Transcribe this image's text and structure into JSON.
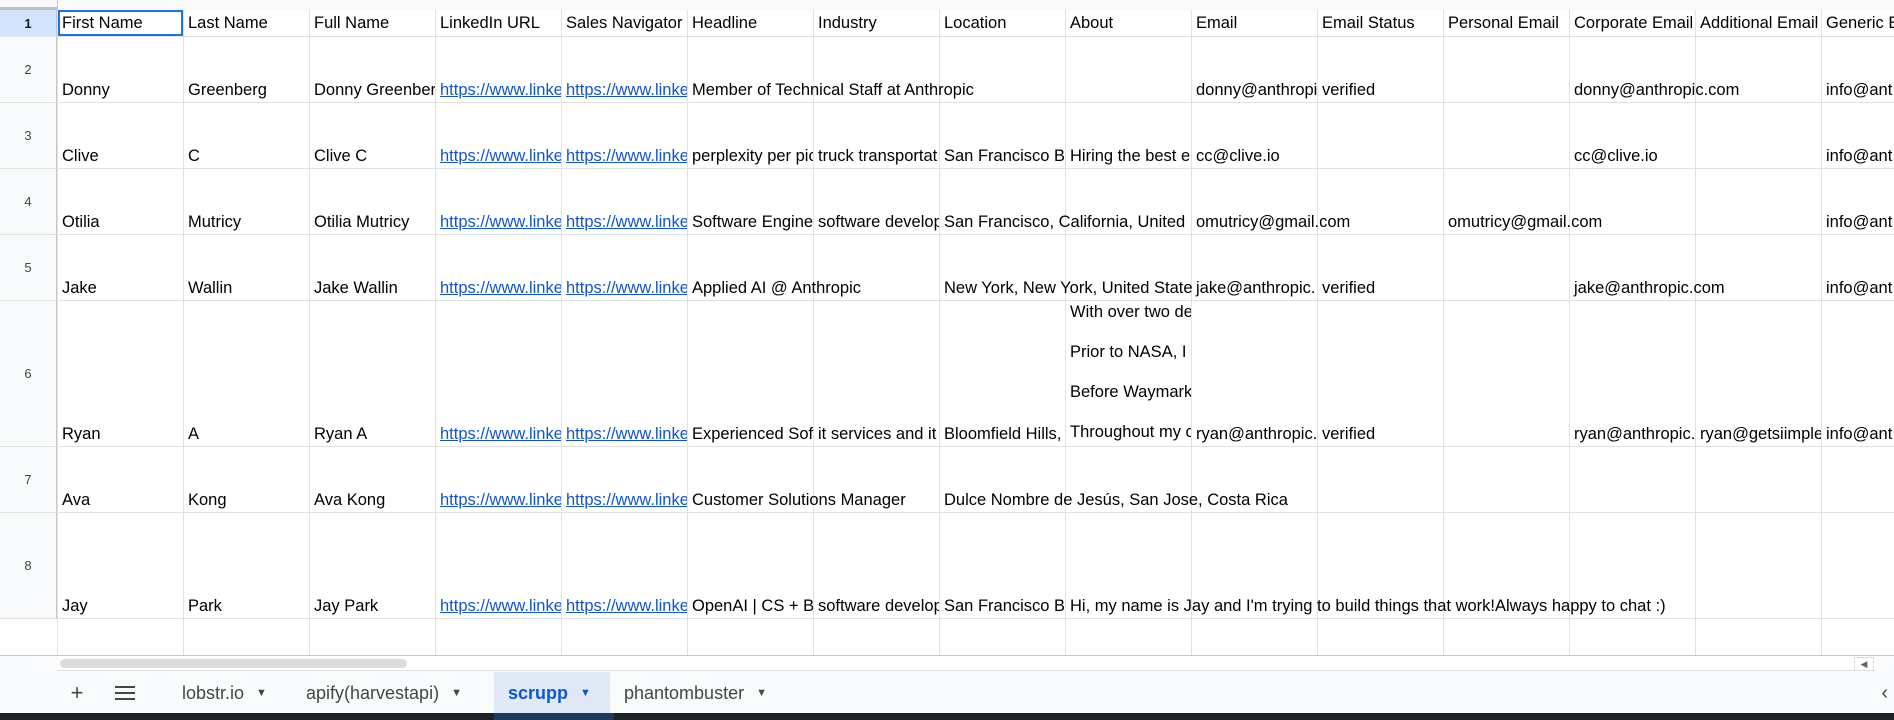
{
  "sheet": {
    "columns": [
      "First Name",
      "Last Name",
      "Full Name",
      "LinkedIn URL",
      "Sales Navigator",
      "Headline",
      "Industry",
      "Location",
      "About",
      "Email",
      "Email Status",
      "Personal Email",
      "Corporate Email",
      "Additional Email",
      "Generic E"
    ],
    "row_numbers": [
      "1",
      "2",
      "3",
      "4",
      "5",
      "6",
      "7",
      "8"
    ],
    "rows": [
      {
        "first": "Donny",
        "last": "Greenberg",
        "full": "Donny Greenber",
        "linkedin": "https://www.linke",
        "salesnav": "https://www.linke",
        "headline": "Member of Technical Staff at Anthropic",
        "industry": "",
        "location": "",
        "about": "",
        "email": "donny@anthropi",
        "email_status": "verified",
        "personal_email": "",
        "corporate_email": "donny@anthropic.com",
        "additional_email": "",
        "generic": "info@ant"
      },
      {
        "first": "Clive",
        "last": "C",
        "full": "Clive C",
        "linkedin": "https://www.linke",
        "salesnav": "https://www.linke",
        "headline": "perplexity per pic",
        "industry": "truck transportat",
        "location": "San Francisco B",
        "about": "Hiring the best e",
        "email": "cc@clive.io",
        "email_status": "",
        "personal_email": "",
        "corporate_email": "cc@clive.io",
        "additional_email": "",
        "generic": "info@ant"
      },
      {
        "first": "Otilia",
        "last": "Mutricy",
        "full": "Otilia Mutricy",
        "linkedin": "https://www.linke",
        "salesnav": "https://www.linke",
        "headline": "Software Engine",
        "industry": "software develop",
        "location": "San Francisco, California, United",
        "about": "",
        "email": "omutricy@gmail.com",
        "email_status": "",
        "personal_email": "omutricy@gmail.com",
        "corporate_email": "",
        "additional_email": "",
        "generic": "info@ant"
      },
      {
        "first": "Jake",
        "last": "Wallin",
        "full": "Jake Wallin",
        "linkedin": "https://www.linke",
        "salesnav": "https://www.linke",
        "headline": "Applied AI @ Anthropic",
        "industry": "",
        "location": "New York, New York, United State",
        "about": "",
        "email": "jake@anthropic.",
        "email_status": "verified",
        "personal_email": "",
        "corporate_email": "jake@anthropic.com",
        "additional_email": "",
        "generic": "info@ant"
      },
      {
        "first": "Ryan",
        "last": "A",
        "full": "Ryan A",
        "linkedin": "https://www.linke",
        "salesnav": "https://www.linke",
        "headline": "Experienced Sof",
        "industry": "it services and it",
        "location": "Bloomfield Hills,",
        "about_lines": [
          "With over two de",
          "Prior to NASA, I",
          "Before Waymark",
          "Throughout my c"
        ],
        "email": "ryan@anthropic.",
        "email_status": "verified",
        "personal_email": "",
        "corporate_email": "ryan@anthropic.",
        "additional_email": "ryan@getsiimple",
        "generic": "info@ant"
      },
      {
        "first": "Ava",
        "last": "Kong",
        "full": "Ava Kong",
        "linkedin": "https://www.linke",
        "salesnav": "https://www.linke",
        "headline": "Customer Solutions Manager",
        "industry": "",
        "location": "Dulce Nombre de Jesús, San Jose, Costa Rica",
        "about": "",
        "email": "",
        "email_status": "",
        "personal_email": "",
        "corporate_email": "",
        "additional_email": "",
        "generic": ""
      },
      {
        "first": "Jay",
        "last": "Park",
        "full": "Jay Park",
        "linkedin": "https://www.linke",
        "salesnav": "https://www.linke",
        "headline": "OpenAI | CS + B",
        "industry": "software develop",
        "location": "San Francisco B",
        "about": "Hi, my name is Jay and I'm trying to build things that work!Always happy to chat :)",
        "email": "",
        "email_status": "",
        "personal_email": "",
        "corporate_email": "",
        "additional_email": "",
        "generic": ""
      }
    ]
  },
  "bottom_bar": {
    "add_icon": "plus-icon",
    "all_sheets_icon": "hamburger-menu-icon",
    "tabs": [
      {
        "label": "lobstr.io",
        "active": false
      },
      {
        "label": "apify(harvestapi)",
        "active": false
      },
      {
        "label": "scrupp",
        "active": true
      },
      {
        "label": "phantombuster",
        "active": false
      }
    ],
    "collapse_icon": "chevron-left-icon"
  },
  "colors": {
    "link": "#1155cc",
    "active_tab": "#0b57d0",
    "selection": "#1a73e8"
  }
}
